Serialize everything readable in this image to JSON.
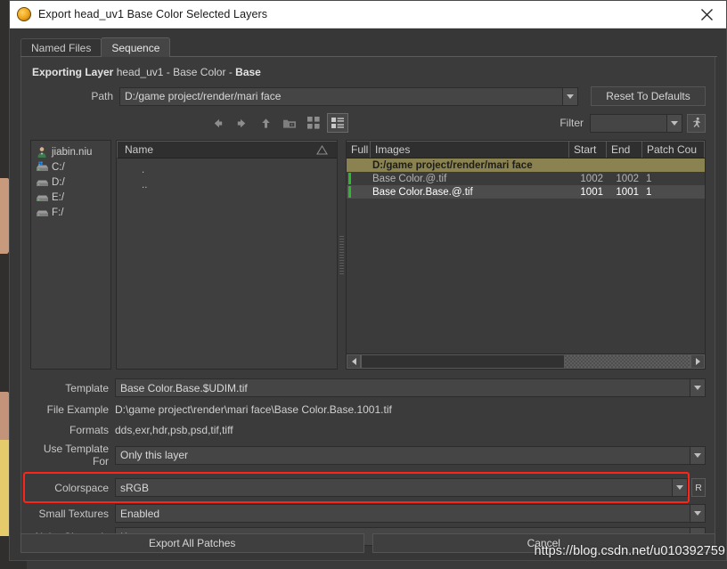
{
  "window": {
    "title": "Export head_uv1 Base Color Selected Layers",
    "app_icon": "mari-logo-icon",
    "close_icon": "close-icon"
  },
  "tabs": [
    {
      "label": "Named Files",
      "active": false
    },
    {
      "label": "Sequence",
      "active": true
    }
  ],
  "exporting": {
    "label": "Exporting Layer",
    "object": "head_uv1",
    "sep1": "-",
    "channel": "Base Color",
    "sep2": "-",
    "layer": "Base"
  },
  "path_row": {
    "label": "Path",
    "value": "D:/game project/render/mari face",
    "reset_button": "Reset To Defaults"
  },
  "navbar": {
    "icons": [
      "back-arrow-icon",
      "forward-arrow-icon",
      "up-arrow-icon",
      "new-folder-icon",
      "grid-view-icon",
      "list-view-icon"
    ],
    "filter_label": "Filter",
    "filter_value": "",
    "filter_placeholder": "",
    "walker_icon": "walking-figure-icon"
  },
  "places": {
    "items": [
      {
        "label": "jiabin.niu",
        "icon": "user-home-icon"
      },
      {
        "label": "C:/",
        "icon": "system-drive-icon"
      },
      {
        "label": "D:/",
        "icon": "drive-icon"
      },
      {
        "label": "E:/",
        "icon": "drive-icon"
      },
      {
        "label": "F:/",
        "icon": "drive-icon"
      }
    ]
  },
  "file_list": {
    "header": "Name",
    "sort_icon": "sort-ascending-icon",
    "rows": [
      ".",
      ".."
    ]
  },
  "images_table": {
    "columns": [
      "Full",
      "Images",
      "Start",
      "End",
      "Patch Cou"
    ],
    "folder_row": "D:/game project/render/mari face",
    "rows": [
      {
        "name": "Base Color.@.tif",
        "start": "1002",
        "end": "1002",
        "patch_count": "1",
        "selected": false,
        "marked": true
      },
      {
        "name": "Base Color.Base.@.tif",
        "start": "1001",
        "end": "1001",
        "patch_count": "1",
        "selected": true,
        "marked": true
      }
    ],
    "scroll": {
      "left_icon": "scroll-left-arrow-icon",
      "right_icon": "scroll-right-arrow-icon"
    }
  },
  "settings": {
    "template": {
      "label": "Template",
      "value": "Base Color.Base.$UDIM.tif"
    },
    "file_example": {
      "label": "File Example",
      "value": "D:\\game project\\render\\mari face\\Base Color.Base.1001.tif"
    },
    "formats": {
      "label": "Formats",
      "value": "dds,exr,hdr,psb,psd,tif,tiff"
    },
    "use_template_for": {
      "label": "Use Template For",
      "value": "Only this layer"
    },
    "colorspace": {
      "label": "Colorspace",
      "value": "sRGB",
      "reset_label": "R",
      "highlight_color": "#ff2418"
    },
    "small_textures": {
      "label": "Small Textures",
      "value": "Enabled"
    },
    "alpha_channels": {
      "label": "Alpha Channels",
      "value": "Keep"
    }
  },
  "footer": {
    "export_label": "Export All Patches",
    "cancel_label": "Cancel"
  },
  "watermark": "https://blog.csdn.net/u010392759"
}
